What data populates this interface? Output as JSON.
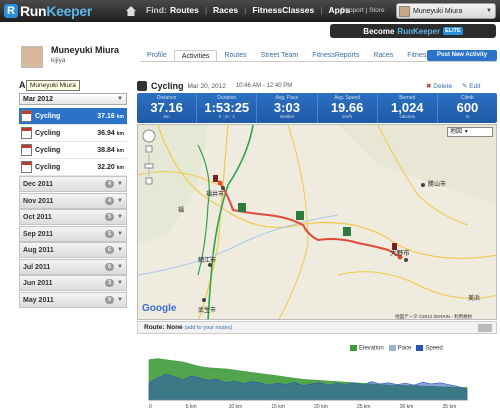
{
  "topbar": {
    "logo_prefix": "Run",
    "logo_suffix": "Keeper",
    "find_label": "Find:",
    "nav": [
      "Routes",
      "Races",
      "FitnessClasses",
      "Apps"
    ],
    "support": "Support | Store",
    "user_name": "Muneyuki Miura"
  },
  "become": {
    "text": "Become",
    "brand": "RunKeeper",
    "badge": "ELITE"
  },
  "profile": {
    "name": "Muneyuki Miura",
    "sub": "kijiya"
  },
  "tabs": [
    "Profile",
    "Activities",
    "Routes",
    "Street Team",
    "FitnessReports",
    "Races",
    "FitnessClasses"
  ],
  "post_button": "Post New Activity",
  "sidebar": {
    "title": "Activi",
    "tooltip": "Muneyuki Miura",
    "month_selected": "Mar 2012",
    "activities": [
      {
        "day": "20",
        "label": "Cycling",
        "dist": "37.16",
        "unit": "km"
      },
      {
        "day": "18",
        "label": "Cycling",
        "dist": "36.94",
        "unit": "km"
      },
      {
        "day": "14",
        "label": "Cycling",
        "dist": "38.84",
        "unit": "km"
      },
      {
        "day": "4",
        "label": "Cycling",
        "dist": "32.20",
        "unit": "km"
      }
    ],
    "months": [
      {
        "label": "Dec 2011",
        "count": "4"
      },
      {
        "label": "Nov 2011",
        "count": "4"
      },
      {
        "label": "Oct 2011",
        "count": "5"
      },
      {
        "label": "Sep 2011",
        "count": "5"
      },
      {
        "label": "Aug 2011",
        "count": "6"
      },
      {
        "label": "Jul 2011",
        "count": "6"
      },
      {
        "label": "Jun 2011",
        "count": "3"
      },
      {
        "label": "May 2011",
        "count": "9"
      }
    ]
  },
  "activity": {
    "type": "Cycling",
    "date": "Mar 20, 2012",
    "time": "10:46 AM - 12:40 PM",
    "delete": "Delete",
    "edit": "Edit",
    "stats": [
      {
        "label": "Distance",
        "value": "37.16",
        "unit": "km"
      },
      {
        "label": "Duration",
        "value": "1:53:25",
        "unit": "h : m : s"
      },
      {
        "label": "Avg. Pace",
        "value": "3:03",
        "unit": "min/km"
      },
      {
        "label": "Avg. Speed",
        "value": "19.66",
        "unit": "km/h"
      },
      {
        "label": "Burned",
        "value": "1,024",
        "unit": "calories"
      },
      {
        "label": "Climb",
        "value": "600",
        "unit": "m"
      }
    ]
  },
  "map": {
    "type_label": "地図",
    "google": "Google",
    "copyright": "地図データ ©2012 ZENRIN - 利用規約",
    "places": [
      "福井市",
      "勝山市",
      "大野市",
      "鯖江市",
      "武生市",
      "美浜",
      "福"
    ]
  },
  "route": {
    "label": "Route:",
    "value": "None",
    "link": "(add to your routes)"
  },
  "legend": [
    "Elevation",
    "Pace",
    "Speed"
  ],
  "colors": {
    "elevation": "#3f9a3a",
    "pace": "#9fb4cf",
    "speed": "#2a55b8"
  },
  "chart_data": {
    "type": "area",
    "x_ticks": [
      "0",
      "5 km",
      "10 km",
      "15 km",
      "20 km",
      "25 km",
      "30 km",
      "35 km"
    ],
    "xlim": [
      0,
      37.16
    ],
    "series": [
      {
        "name": "Elevation",
        "x": [
          0,
          1,
          2,
          3,
          4,
          5,
          6,
          7,
          8,
          9,
          10,
          11,
          12,
          13,
          14,
          15,
          16,
          17,
          18,
          19,
          20,
          21,
          22,
          23,
          24,
          25,
          26,
          27,
          28,
          29,
          30,
          31,
          32,
          33,
          34,
          35,
          36,
          37.16
        ],
        "values": [
          70,
          72,
          70,
          68,
          66,
          62,
          58,
          56,
          55,
          54,
          52,
          50,
          48,
          46,
          44,
          42,
          40,
          38,
          36,
          35,
          34,
          33,
          32,
          31,
          30,
          29,
          28,
          27,
          26,
          26,
          25,
          25,
          24,
          24,
          23,
          23,
          22,
          22
        ]
      },
      {
        "name": "Speed",
        "x": [
          0,
          1,
          2,
          3,
          4,
          5,
          6,
          7,
          8,
          9,
          10,
          11,
          12,
          13,
          14,
          15,
          16,
          17,
          18,
          19,
          20,
          21,
          22,
          23,
          24,
          25,
          26,
          27,
          28,
          29,
          30,
          31,
          32,
          33,
          34,
          35,
          36,
          37.16
        ],
        "values": [
          30,
          38,
          45,
          40,
          35,
          42,
          38,
          34,
          36,
          30,
          33,
          28,
          32,
          30,
          26,
          29,
          27,
          31,
          25,
          28,
          30,
          26,
          29,
          27,
          30,
          26,
          32,
          28,
          30,
          27,
          29,
          26,
          31,
          28,
          30,
          27,
          24,
          18
        ]
      }
    ]
  }
}
